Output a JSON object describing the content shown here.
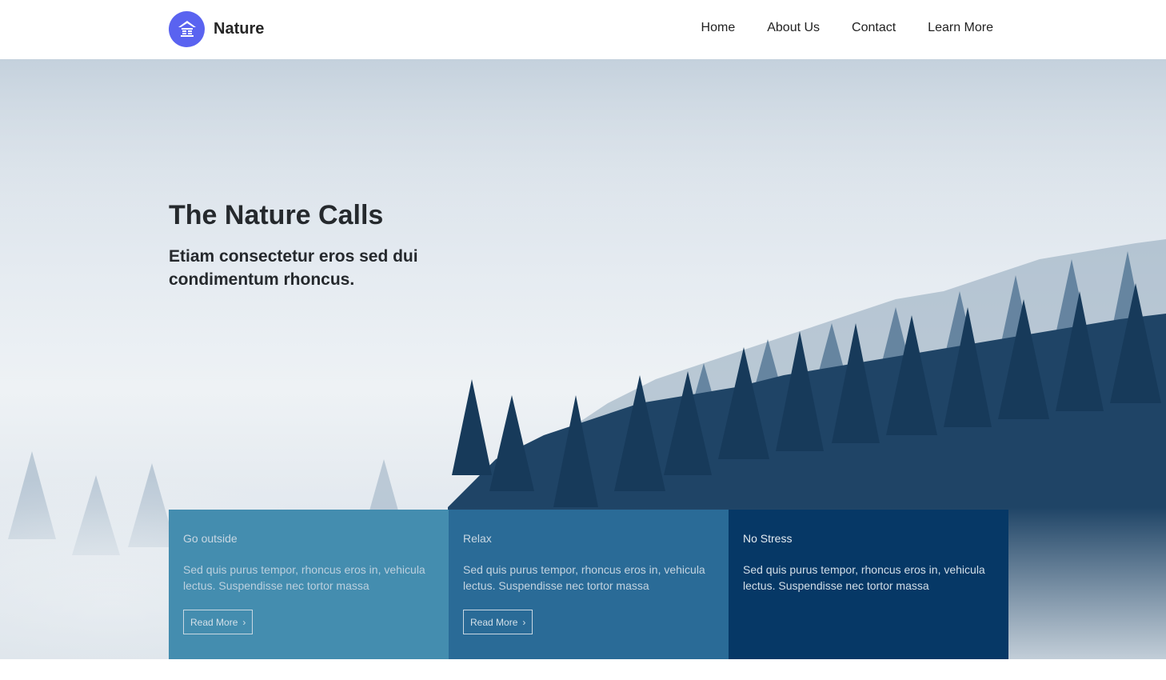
{
  "brand": {
    "name": "Nature",
    "logo_icon": "house-icon",
    "logo_color": "#5a63f0"
  },
  "nav": {
    "items": [
      {
        "label": "Home"
      },
      {
        "label": "About Us"
      },
      {
        "label": "Contact"
      },
      {
        "label": "Learn More"
      }
    ]
  },
  "hero": {
    "title": "The Nature Calls",
    "subtitle": "Etiam consectetur eros sed dui condimentum rhoncus."
  },
  "cards": [
    {
      "title": "Go outside",
      "text": "Sed quis purus tempor, rhoncus eros in, vehicula lectus. Suspendisse nec tortor massa",
      "button": "Read More",
      "color": "#448daf"
    },
    {
      "title": "Relax",
      "text": "Sed quis purus tempor, rhoncus eros in, vehicula lectus. Suspendisse nec tortor massa",
      "button": "Read More",
      "color": "#2a6b97"
    },
    {
      "title": "No Stress",
      "text": "Sed quis purus tempor, rhoncus eros in, vehicula lectus. Suspendisse nec tortor massa",
      "color": "#063866"
    }
  ]
}
